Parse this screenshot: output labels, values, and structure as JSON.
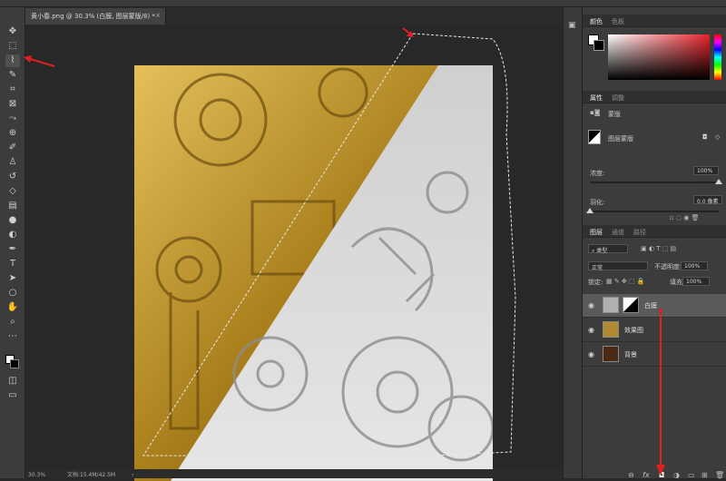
{
  "document": {
    "tab_title": "黄小春.png @ 30.3% (白膜, 图层蒙版/8) *",
    "close": "×"
  },
  "status": {
    "zoom": "30.3%",
    "doc_size": "文档:15.4M/42.5M",
    "arrow": "›"
  },
  "color_panel": {
    "tabs": [
      "颜色",
      "色板"
    ]
  },
  "properties_panel": {
    "tabs": [
      "属性",
      "调整"
    ],
    "mask_title": "蒙版",
    "mask_type": "图层蒙版",
    "density_label": "浓度:",
    "density_value": "100%",
    "feather_label": "羽化:",
    "feather_value": "0.0 像素"
  },
  "layers_panel": {
    "tabs": [
      "图层",
      "通道",
      "路径"
    ],
    "filter_kind": "类型",
    "blend_mode": "正常",
    "opacity_label": "不透明度:",
    "opacity_value": "100%",
    "lock_label": "锁定:",
    "fill_label": "填充:",
    "fill_value": "100%",
    "layers": [
      {
        "name": "白膜",
        "selected": true
      },
      {
        "name": "效果图",
        "selected": false
      },
      {
        "name": "背景",
        "selected": false
      }
    ],
    "bottom_fx": "fx"
  },
  "colors": {
    "gold": "#c9a23a",
    "white_render": "#d8d8d8",
    "annotation_red": "#e02020"
  }
}
